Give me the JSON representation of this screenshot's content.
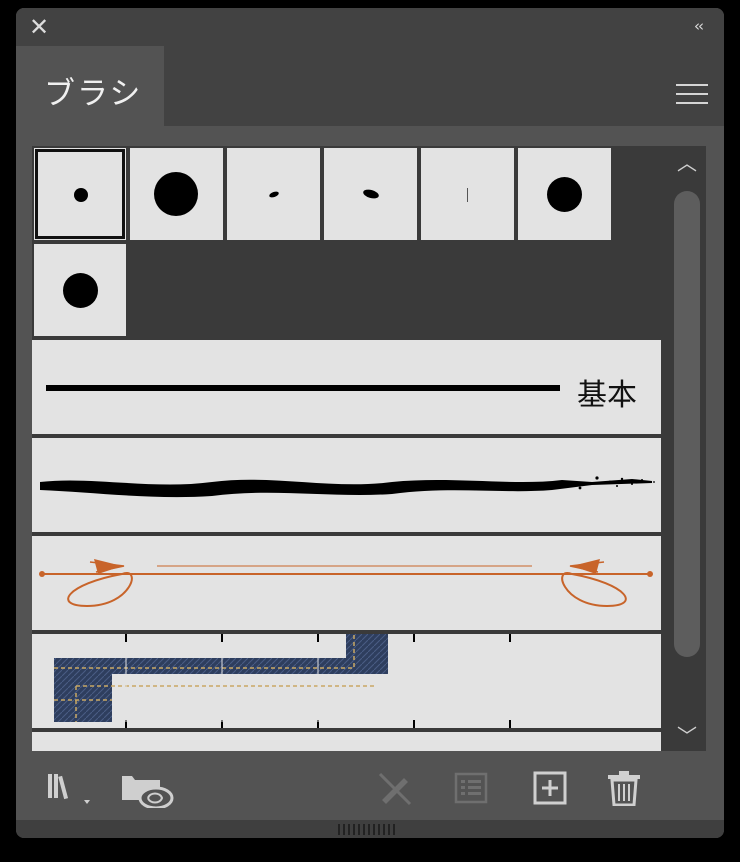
{
  "window": {
    "close_icon": "close-icon",
    "collapse_label": "‹‹"
  },
  "tabs": [
    {
      "label": "ブラシ",
      "active": true
    }
  ],
  "menu_icon": "hamburger-menu-icon",
  "brushes": {
    "basic_label": "基本"
  },
  "footer": {
    "icons": [
      "brush-library-icon",
      "cc-library-icon",
      "remove-brush-stroke-icon",
      "brush-options-icon",
      "new-brush-icon",
      "trash-icon"
    ]
  },
  "colors": {
    "panel_bg": "#535353",
    "title_bg": "#424242",
    "list_bg": "#3a3a3a",
    "cell_bg": "#e3e3e3",
    "arrow_brush": "#c8642a",
    "denim": "#2e3e5e"
  }
}
